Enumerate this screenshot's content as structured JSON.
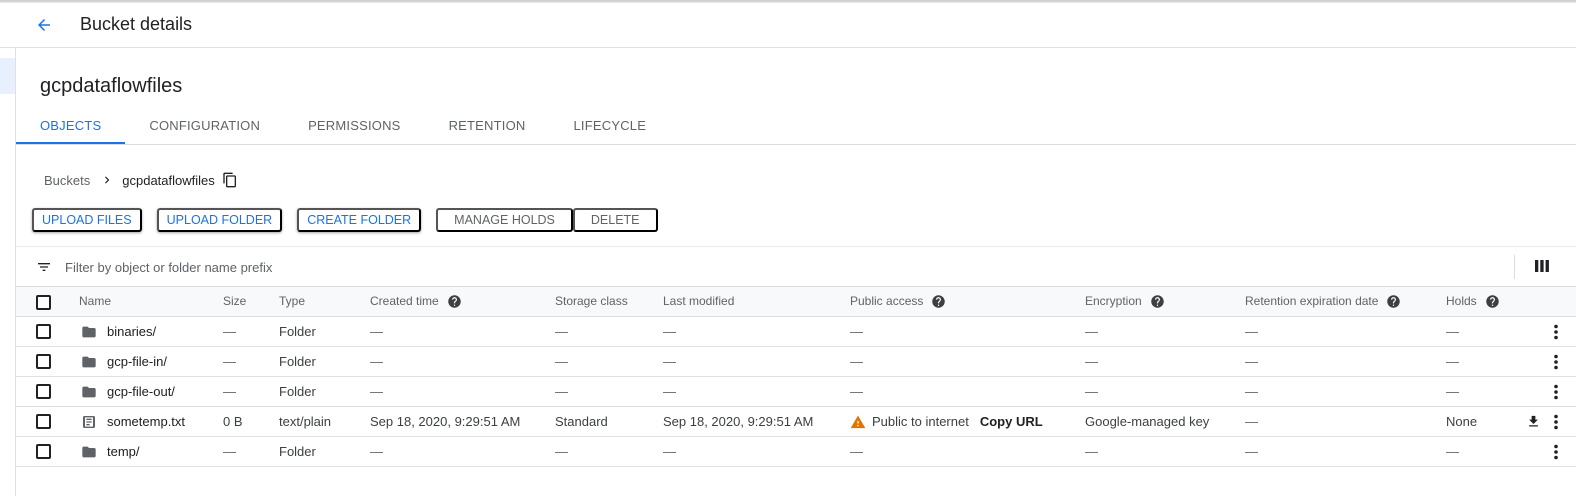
{
  "header": {
    "title": "Bucket details"
  },
  "bucket": {
    "name": "gcpdataflowfiles"
  },
  "tabs": [
    {
      "label": "OBJECTS",
      "active": true
    },
    {
      "label": "CONFIGURATION"
    },
    {
      "label": "PERMISSIONS"
    },
    {
      "label": "RETENTION"
    },
    {
      "label": "LIFECYCLE"
    }
  ],
  "breadcrumb": {
    "root": "Buckets",
    "current": "gcpdataflowfiles"
  },
  "toolbar": {
    "upload_files": "UPLOAD FILES",
    "upload_folder": "UPLOAD FOLDER",
    "create_folder": "CREATE FOLDER",
    "manage_holds": "MANAGE HOLDS",
    "delete": "DELETE"
  },
  "filter": {
    "placeholder": "Filter by object or folder name prefix"
  },
  "table": {
    "columns": {
      "name": "Name",
      "size": "Size",
      "type": "Type",
      "created": "Created time",
      "storage": "Storage class",
      "modified": "Last modified",
      "public": "Public access",
      "encryption": "Encryption",
      "retention": "Retention expiration date",
      "holds": "Holds"
    },
    "rows": [
      {
        "icon": "folder-icon",
        "name": "binaries/",
        "size": "—",
        "type": "Folder",
        "created": "—",
        "storage": "—",
        "modified": "—",
        "public": "—",
        "encryption": "—",
        "retention": "—",
        "holds": "—"
      },
      {
        "icon": "folder-icon",
        "name": "gcp-file-in/",
        "size": "—",
        "type": "Folder",
        "created": "—",
        "storage": "—",
        "modified": "—",
        "public": "—",
        "encryption": "—",
        "retention": "—",
        "holds": "—"
      },
      {
        "icon": "folder-icon",
        "name": "gcp-file-out/",
        "size": "—",
        "type": "Folder",
        "created": "—",
        "storage": "—",
        "modified": "—",
        "public": "—",
        "encryption": "—",
        "retention": "—",
        "holds": "—"
      },
      {
        "icon": "file-icon",
        "name": "sometemp.txt",
        "size": "0 B",
        "type": "text/plain",
        "created": "Sep 18, 2020, 9:29:51 AM",
        "storage": "Standard",
        "modified": "Sep 18, 2020, 9:29:51 AM",
        "public": "Public to internet",
        "public_link": "Copy URL",
        "encryption": "Google-managed key",
        "retention": "—",
        "holds": "None"
      },
      {
        "icon": "folder-icon",
        "name": "temp/",
        "size": "—",
        "type": "Folder",
        "created": "—",
        "storage": "—",
        "modified": "—",
        "public": "—",
        "encryption": "—",
        "retention": "—",
        "holds": "—"
      }
    ]
  },
  "colors": {
    "accent": "#1a73e8",
    "warning": "#e37400",
    "icon_grey": "#5f6368"
  }
}
